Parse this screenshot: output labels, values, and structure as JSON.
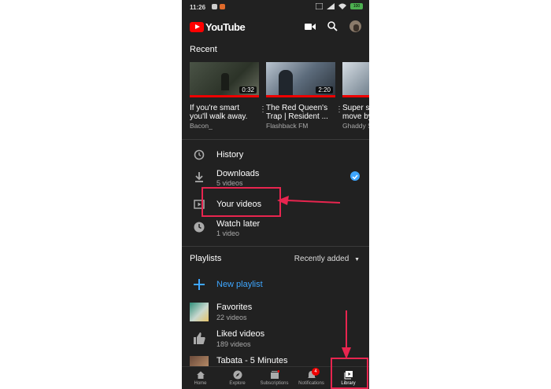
{
  "status": {
    "time": "11:26",
    "battery": "100"
  },
  "app": {
    "logo_text": "YouTube"
  },
  "recent": {
    "title": "Recent",
    "videos": [
      {
        "title_l1": "If you're smart",
        "title_l2": "you'll walk away.",
        "channel": "Bacon_",
        "duration": "0:32"
      },
      {
        "title_l1": "The Red Queen's",
        "title_l2": "Trap | Resident ...",
        "channel": "Flashback FM",
        "duration": "2:20"
      },
      {
        "title_l1": "Super s",
        "title_l2": "move by",
        "channel": "Ghaddy S",
        "duration": ""
      }
    ]
  },
  "library": {
    "history": "History",
    "downloads": "Downloads",
    "downloads_meta": "5 videos",
    "your_videos": "Your videos",
    "watch_later": "Watch later",
    "watch_later_meta": "1 video"
  },
  "playlists": {
    "title": "Playlists",
    "sort_label": "Recently added",
    "new_playlist": "New playlist",
    "items": [
      {
        "name": "Favorites",
        "meta": "22 videos"
      },
      {
        "name": "Liked videos",
        "meta": "189 videos"
      },
      {
        "name": "Tabata - 5 Minutes",
        "meta": ""
      }
    ]
  },
  "nav": {
    "home": "Home",
    "explore": "Explore",
    "subscriptions": "Subscriptions",
    "notifications": "Notifications",
    "notifications_badge": "4",
    "library": "Library"
  },
  "colors": {
    "accent": "#3ea6ff",
    "brand": "#ff0000",
    "highlight": "#e8254f"
  }
}
